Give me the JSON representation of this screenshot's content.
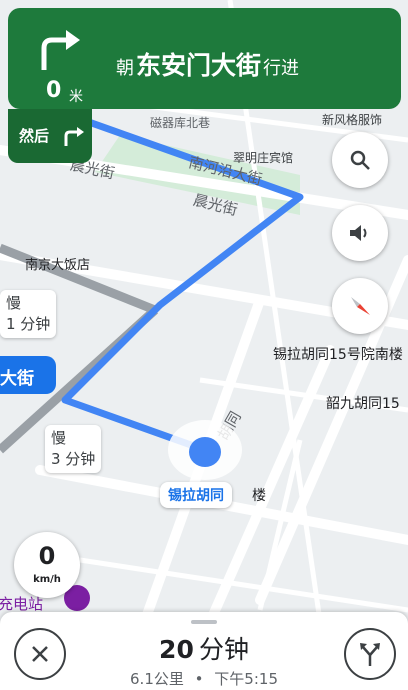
{
  "banner": {
    "distance": "0",
    "distance_unit": "米",
    "prefix": "朝",
    "street": "东安门大街",
    "suffix": "行进",
    "then_label": "然后",
    "turn_icon": "turn-right-icon"
  },
  "map": {
    "labels": {
      "lane_hutong": "磁器库北巷",
      "xinfengge": "新风格服饰",
      "cuiming": "翠明庄宾馆",
      "nanhe_ave": "南河沿大街",
      "chenguang_top": "晨光街",
      "chenguang_right": "晨光街",
      "nanjing_hotel": "南京大饭店",
      "courtyard15": "锡拉胡同15号院南楼",
      "shaojiu": "韶九胡同15",
      "hutong_road": "胡同",
      "building_suffix": "楼",
      "charging": "充电站"
    },
    "street_pill": "大街",
    "current_location": "锡拉胡同",
    "traffic": [
      {
        "status": "慢",
        "time": "1 分钟"
      },
      {
        "status": "慢",
        "time": "3 分钟"
      }
    ]
  },
  "speed": {
    "value": "0",
    "unit": "km/h"
  },
  "controls": {
    "search_icon": "search-icon",
    "sound_icon": "volume-icon",
    "compass_icon": "compass-icon"
  },
  "bottom": {
    "eta_number": "20",
    "eta_unit": "分钟",
    "distance": "6.1公里",
    "separator": "•",
    "arrival": "下午5:15",
    "close_icon": "close-icon",
    "routes_icon": "alternate-routes-icon"
  },
  "colors": {
    "banner": "#1e7a3c",
    "then_box": "#1a6933",
    "route": "#4285f4",
    "location": "#1a73e8"
  }
}
